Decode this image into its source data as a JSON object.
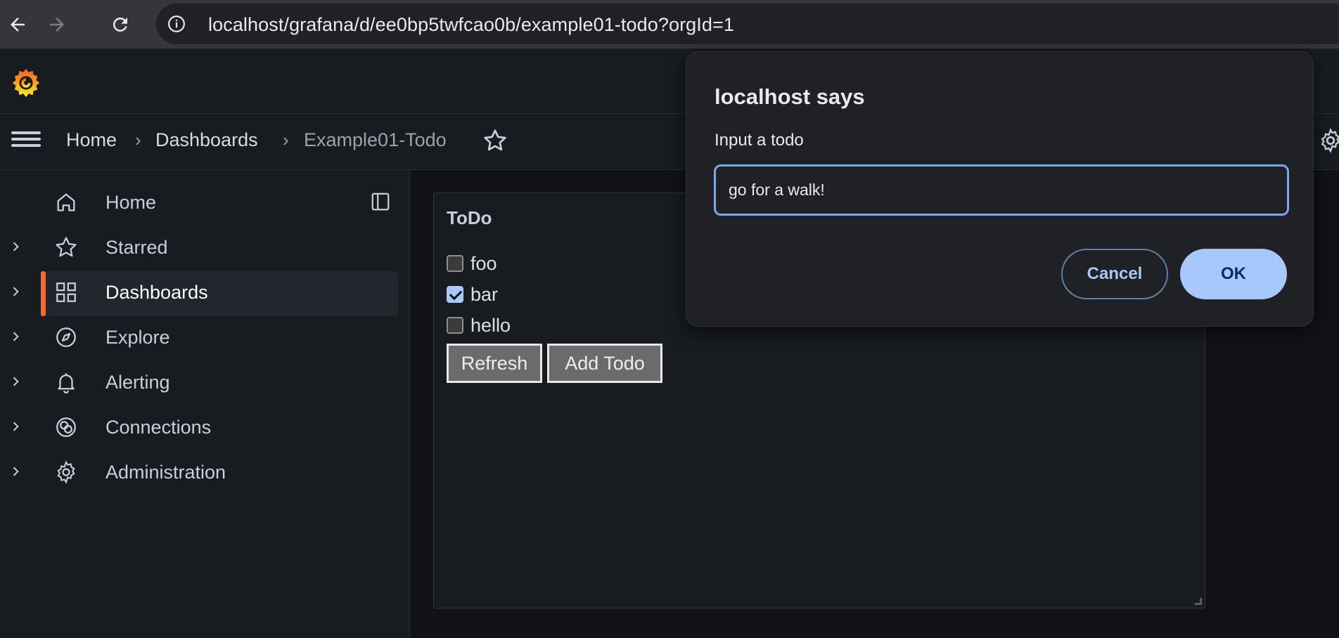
{
  "browser": {
    "url": "localhost/grafana/d/ee0bp5twfcao0b/example01-todo?orgId=1"
  },
  "breadcrumb": {
    "items": [
      "Home",
      "Dashboards",
      "Example01-Todo"
    ],
    "separator": "›"
  },
  "sidebar": {
    "items": [
      {
        "label": "Home",
        "icon": "home-icon",
        "expandable": false
      },
      {
        "label": "Starred",
        "icon": "star-icon",
        "expandable": true
      },
      {
        "label": "Dashboards",
        "icon": "grid-icon",
        "expandable": true,
        "active": true
      },
      {
        "label": "Explore",
        "icon": "compass-icon",
        "expandable": true
      },
      {
        "label": "Alerting",
        "icon": "bell-icon",
        "expandable": true
      },
      {
        "label": "Connections",
        "icon": "connections-icon",
        "expandable": true
      },
      {
        "label": "Administration",
        "icon": "gear-icon",
        "expandable": true
      }
    ]
  },
  "panel": {
    "title": "ToDo",
    "todos": [
      {
        "label": "foo",
        "checked": false
      },
      {
        "label": "bar",
        "checked": true
      },
      {
        "label": "hello",
        "checked": false
      }
    ],
    "refresh_label": "Refresh",
    "add_label": "Add Todo"
  },
  "dialog": {
    "title": "localhost says",
    "message": "Input a todo",
    "input_value": "go for a walk!",
    "cancel_label": "Cancel",
    "ok_label": "OK"
  },
  "colors": {
    "accent": "#f66c30",
    "dialog_primary": "#a8c7fa"
  }
}
